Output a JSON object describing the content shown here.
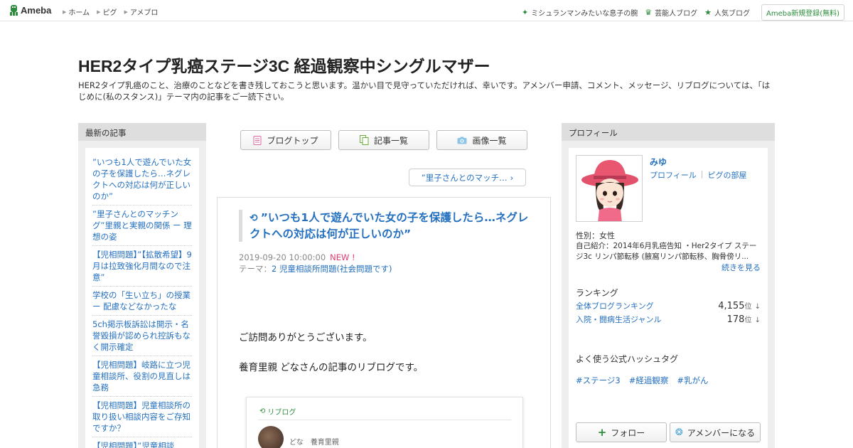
{
  "topbar": {
    "logo": "Ameba",
    "nav": [
      "ホーム",
      "ピグ",
      "アメブロ"
    ],
    "right_links": [
      {
        "icon": "sparkle-icon",
        "label": "ミシュランマンみたいな息子の腕"
      },
      {
        "icon": "crown-icon",
        "label": "芸能人ブログ"
      },
      {
        "icon": "star-icon",
        "label": "人気ブログ"
      }
    ],
    "register": "Ameba新規登録(無料)"
  },
  "header": {
    "title": "HER2タイプ乳癌ステージ3C 経過観察中シングルマザー",
    "description": "HER2タイプ乳癌のこと、治療のことなどを書き残しておこうと思います。温かい目で見守っていただければ、幸いです。アメンバー申請、コメント、メッセージ、リブログについては、「はじめに(私のスタンス)」テーマ内の記事をご一読下さい。"
  },
  "left": {
    "heading": "最新の記事",
    "items": [
      "”いつも1人で遊んでいた女の子を保護したら…ネグレクトへの対応は何が正しいのか”",
      "”里子さんとのマッチング”里親と実親の関係 ー 理想の姿",
      "【児相問題】”【拡散希望】9月は拉致強化月間なので注意”",
      "学校の「生い立ち」の授業 ー 配慮などなかったな",
      "5ch掲示板訴訟は開示・名誉毀損が認められ控訴もなく開示確定",
      "【児相問題】岐路に立つ児童相談所、役割の見直しは急務",
      "【児相問題】児童相談所の取り扱い相談内容をご存知ですか？",
      "【児相問題】”児童相談所”職員育成の問題 里親"
    ]
  },
  "center": {
    "nav": [
      {
        "icon": "document-icon",
        "label": "ブログトップ"
      },
      {
        "icon": "copy-icon",
        "label": "記事一覧"
      },
      {
        "icon": "camera-icon",
        "label": "画像一覧"
      }
    ],
    "next_link": "”里子さんとのマッチ…",
    "article": {
      "title": "”いつも1人で遊んでいた女の子を保護したら…ネグレクトへの対応は何が正しいのか”",
      "date": "2019-09-20 10:00:00",
      "new_label": "NEW !",
      "theme_prefix": "テーマ：",
      "theme": "2 児童相談所問題(社会問題です)",
      "body": [
        "ご訪問ありがとうございます。",
        "養育里親 どなさんの記事のリブログです。"
      ],
      "reblog": {
        "label": "リブログ",
        "author": "どな",
        "author_desc": "養育里親"
      }
    }
  },
  "right": {
    "heading": "プロフィール",
    "name": "みゆ",
    "links": [
      "プロフィール",
      "ピグの部屋"
    ],
    "gender": "性別：女性",
    "intro": "自己紹介：2014年6月乳癌告知 ・Her2タイプ ステージ3c リンパ節転移 (腋窩リンパ節転移、胸骨傍リ...",
    "more": "続きを見る",
    "ranking_heading": "ランキング",
    "rankings": [
      {
        "name": "全体ブログランキング",
        "value": "4,155",
        "unit": "位",
        "trend": "↓"
      },
      {
        "name": "入院・闘病生活ジャンル",
        "value": "178",
        "unit": "位",
        "trend": "↓"
      }
    ],
    "hashtag_heading": "よく使う公式ハッシュタグ",
    "hashtags": [
      "#ステージ3",
      "#経過観察",
      "#乳がん"
    ],
    "buttons": [
      "フォロー",
      "アメンバーになる"
    ]
  }
}
